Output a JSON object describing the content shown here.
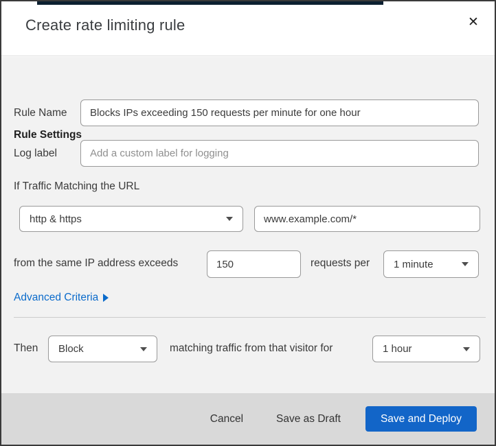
{
  "dialog": {
    "title": "Create rate limiting rule",
    "close_icon": "✕"
  },
  "form": {
    "section_heading": "Rule Settings",
    "rule_name": {
      "label": "Rule Name",
      "value": "Blocks IPs exceeding 150 requests per minute for one hour"
    },
    "log_label": {
      "label": "Log label",
      "placeholder": "Add a custom label for logging"
    },
    "traffic_match": {
      "intro": "If Traffic Matching the URL",
      "scheme_select": {
        "value": "http & https"
      },
      "url_input": {
        "value": "www.example.com/*"
      },
      "threshold_text_before": "from the same IP address exceeds",
      "threshold_input": {
        "value": "150"
      },
      "threshold_text_after": "requests per",
      "period_select": {
        "value": "1 minute"
      },
      "advanced_link": "Advanced Criteria"
    },
    "action": {
      "then_label": "Then",
      "action_select": {
        "value": "Block"
      },
      "between_text": "matching traffic from that visitor for",
      "duration_select": {
        "value": "1 hour"
      }
    }
  },
  "footer": {
    "cancel_label": "Cancel",
    "save_draft_label": "Save as Draft",
    "save_deploy_label": "Save and Deploy"
  },
  "colors": {
    "body_bg": "#f2f2f2",
    "footer_bg": "#d9d9d9",
    "primary_button": "#1265c8",
    "link": "#0b6bcb",
    "backdrop_strip": "#0d2031",
    "input_border": "#999999"
  }
}
